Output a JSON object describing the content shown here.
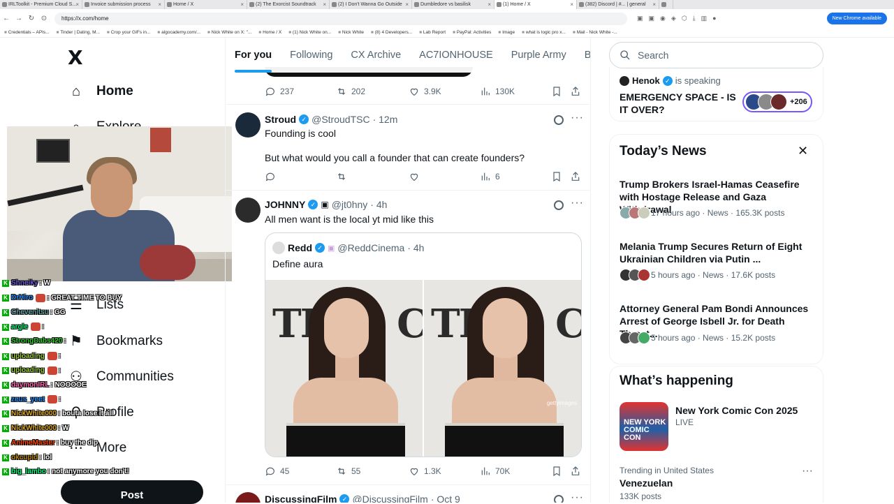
{
  "browser": {
    "tabs": [
      {
        "title": "IRLToolkit - Premium Cloud S..."
      },
      {
        "title": "Invoice submission process"
      },
      {
        "title": "Home / X"
      },
      {
        "title": "(2) The Exorcist Soundtrack"
      },
      {
        "title": "(2) I Don't Wanna Go Outside"
      },
      {
        "title": "Dumbledore vs basilisk"
      },
      {
        "title": "(1) Home / X"
      },
      {
        "title": "(382) Discord | #... | general"
      }
    ],
    "url": "https://x.com/home",
    "new_chrome_label": "New Chrome available",
    "bookmarks": [
      "Credentials – APIs...",
      "Tinder | Dating, M...",
      "Crop your GIFs in...",
      "algocademy.com/...",
      "Nick White on X: \"...",
      "Home / X",
      "(1) Nick White on...",
      "Nick White",
      "(8) 4 Developers...",
      "Lab Report",
      "PayPal: Activities",
      "Image",
      "what is logic pro x...",
      "Mail - Nick White -..."
    ]
  },
  "sidebar": {
    "logo": "X",
    "items": [
      {
        "label": "Home",
        "icon": "home-icon",
        "glyph": "⌂"
      },
      {
        "label": "Explore",
        "icon": "search-icon",
        "glyph": "⌕"
      },
      {
        "label": "Lists",
        "icon": "lists-icon",
        "glyph": "☰"
      },
      {
        "label": "Bookmarks",
        "icon": "bookmark-icon",
        "glyph": "⚑"
      },
      {
        "label": "Communities",
        "icon": "communities-icon",
        "glyph": "⚇"
      },
      {
        "label": "Profile",
        "icon": "profile-icon",
        "glyph": "⚲"
      },
      {
        "label": "More",
        "icon": "more-icon",
        "glyph": "⋯"
      }
    ],
    "post_label": "Post"
  },
  "chat": [
    {
      "user": "Shneiky",
      "msg": ": W",
      "color": "#6a5acd"
    },
    {
      "user": "DrHiro",
      "msg": ": GREAT TIME TO BUY",
      "color": "#1e90ff",
      "emote": true
    },
    {
      "user": "Chevenitsu",
      "msg": ": GG",
      "color": "#5f9ea0"
    },
    {
      "user": "argle",
      "msg": ":",
      "color": "#00ff7f",
      "emote": true
    },
    {
      "user": "StrongDabs420",
      "msg": ":",
      "color": "#32cd32"
    },
    {
      "user": "uploading",
      "msg": ":",
      "color": "#9acd32",
      "emote": true
    },
    {
      "user": "uploading",
      "msg": ":",
      "color": "#9acd32",
      "emote": true
    },
    {
      "user": "daymonIRL",
      "msg": ": NOOOOE",
      "color": "#ff69b4"
    },
    {
      "user": "zeus_yeet",
      "msg": ":",
      "color": "#1e90ff",
      "emote": true
    },
    {
      "user": "NickWhite000",
      "msg": ": bouta lose it all",
      "color": "#daa520"
    },
    {
      "user": "NickWhite000",
      "msg": ": W",
      "color": "#daa520"
    },
    {
      "user": "AnimeMaster",
      "msg": ": buy the dip",
      "color": "#ff4500"
    },
    {
      "user": "okcupid",
      "msg": ": lol",
      "color": "#b8860b"
    },
    {
      "user": "big_lambo",
      "msg": ": not anymore you don't!",
      "color": "#00ff7f"
    }
  ],
  "feed": {
    "tabs": [
      "For you",
      "Following",
      "CX Archive",
      "AC7IONHOUSE",
      "Purple Army",
      "BAS"
    ],
    "prev_actions": {
      "replies": "237",
      "reposts": "202",
      "likes": "3.9K",
      "views": "130K"
    },
    "tweets": [
      {
        "name": "Stroud",
        "handle": "@StroudTSC",
        "time": "· 12m",
        "text1": "Founding is cool",
        "text2": "But what would you call a founder that can create founders?",
        "actions": {
          "replies": "",
          "reposts": "",
          "likes": "",
          "views": "6"
        }
      },
      {
        "name": "JOHNNY",
        "handle": "@jt0hny",
        "time": "· 4h",
        "text1": "All men want is the local yt mid like this",
        "quote": {
          "name": "Redd",
          "handle": "@ReddCinema",
          "time": "· 4h",
          "text": "Define aura",
          "watermark": "gettyimages"
        },
        "actions": {
          "replies": "45",
          "reposts": "55",
          "likes": "1.3K",
          "views": "70K"
        }
      },
      {
        "name": "DiscussingFilm",
        "handle": "@DiscussingFilm",
        "time": "· Oct 9"
      }
    ]
  },
  "right": {
    "search_placeholder": "Search",
    "space": {
      "host": "Henok",
      "status": "is speaking",
      "title": "EMERGENCY SPACE - IS IT OVER?",
      "listeners": "+206"
    },
    "todays_news": {
      "title": "Today’s News",
      "items": [
        {
          "headline": "Trump Brokers Israel-Hamas Ceasefire with Hostage Release and Gaza Withdrawal",
          "meta": "17 hours ago · News · 165.3K posts"
        },
        {
          "headline": "Melania Trump Secures Return of Eight Ukrainian Children via Putin ...",
          "meta": "5 hours ago · News · 17.6K posts"
        },
        {
          "headline": "Attorney General Pam Bondi Announces Arrest of George Isbell Jr. for Death Threat...",
          "meta": "5 hours ago · News · 15.2K posts"
        }
      ]
    },
    "happening": {
      "title": "What’s happening",
      "event": {
        "title": "New York Comic Con 2025",
        "status": "LIVE",
        "image_text": "NEW YORK COMIC CON"
      },
      "trend": {
        "context": "Trending in United States",
        "name": "Venezuelan",
        "count": "133K posts"
      }
    }
  },
  "colors": {
    "accent": "#1d9bf0",
    "text": "#0f1419",
    "muted": "#536471",
    "space_border": "#7856ff"
  }
}
